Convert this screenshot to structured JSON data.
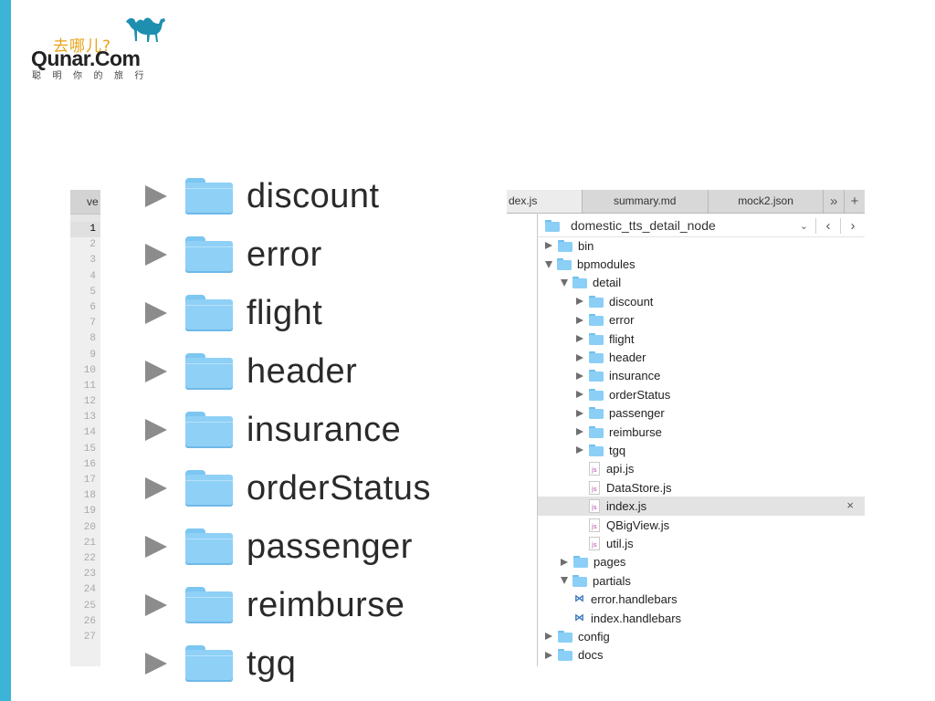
{
  "logo": {
    "cn_text": "去哪儿?",
    "brand": "Qunar.Com",
    "slogan": "聪明你的旅行"
  },
  "colors": {
    "accent_bar": "#3bb4d8",
    "folder": "#8fd0f6",
    "brand_orange": "#e8a317",
    "camel": "#1f8fb0"
  },
  "editor": {
    "tab_label": "ve",
    "current_line": 1,
    "line_numbers": [
      "1",
      "2",
      "3",
      "4",
      "5",
      "6",
      "7",
      "8",
      "9",
      "10",
      "11",
      "12",
      "13",
      "14",
      "15",
      "16",
      "17",
      "18",
      "19",
      "20",
      "21",
      "22",
      "23",
      "24",
      "25",
      "26",
      "27"
    ]
  },
  "zoom_list": {
    "items": [
      {
        "label": "discount",
        "icon": "folder-icon"
      },
      {
        "label": "error",
        "icon": "folder-icon"
      },
      {
        "label": "flight",
        "icon": "folder-icon"
      },
      {
        "label": "header",
        "icon": "folder-icon"
      },
      {
        "label": "insurance",
        "icon": "folder-icon"
      },
      {
        "label": "orderStatus",
        "icon": "folder-icon"
      },
      {
        "label": "passenger",
        "icon": "folder-icon"
      },
      {
        "label": "reimburse",
        "icon": "folder-icon"
      },
      {
        "label": "tgq",
        "icon": "folder-icon"
      }
    ]
  },
  "ide": {
    "tabs": [
      {
        "label": "dex.js",
        "active": true
      },
      {
        "label": "summary.md",
        "active": false
      },
      {
        "label": "mock2.json",
        "active": false
      }
    ],
    "tab_overflow": "»",
    "tab_add": "+",
    "project": {
      "name": "domestic_tts_detail_node",
      "dropdown": "⌄",
      "back": "‹",
      "forward": "›"
    },
    "close_glyph": "×",
    "tree": [
      {
        "label": "bin",
        "type": "folder",
        "depth": 0,
        "state": "collapsed"
      },
      {
        "label": "bpmodules",
        "type": "folder",
        "depth": 0,
        "state": "expanded"
      },
      {
        "label": "detail",
        "type": "folder",
        "depth": 1,
        "state": "expanded"
      },
      {
        "label": "discount",
        "type": "folder",
        "depth": 2,
        "state": "collapsed"
      },
      {
        "label": "error",
        "type": "folder",
        "depth": 2,
        "state": "collapsed"
      },
      {
        "label": "flight",
        "type": "folder",
        "depth": 2,
        "state": "collapsed"
      },
      {
        "label": "header",
        "type": "folder",
        "depth": 2,
        "state": "collapsed"
      },
      {
        "label": "insurance",
        "type": "folder",
        "depth": 2,
        "state": "collapsed"
      },
      {
        "label": "orderStatus",
        "type": "folder",
        "depth": 2,
        "state": "collapsed"
      },
      {
        "label": "passenger",
        "type": "folder",
        "depth": 2,
        "state": "collapsed"
      },
      {
        "label": "reimburse",
        "type": "folder",
        "depth": 2,
        "state": "collapsed"
      },
      {
        "label": "tgq",
        "type": "folder",
        "depth": 2,
        "state": "collapsed"
      },
      {
        "label": "api.js",
        "type": "js",
        "depth": 2
      },
      {
        "label": "DataStore.js",
        "type": "js",
        "depth": 2
      },
      {
        "label": "index.js",
        "type": "js",
        "depth": 2,
        "selected": true
      },
      {
        "label": "QBigView.js",
        "type": "js",
        "depth": 2
      },
      {
        "label": "util.js",
        "type": "js",
        "depth": 2
      },
      {
        "label": "pages",
        "type": "folder",
        "depth": 1,
        "state": "collapsed"
      },
      {
        "label": "partials",
        "type": "folder",
        "depth": 1,
        "state": "expanded"
      },
      {
        "label": "error.handlebars",
        "type": "hbs",
        "depth": 1
      },
      {
        "label": "index.handlebars",
        "type": "hbs",
        "depth": 1
      },
      {
        "label": "config",
        "type": "folder",
        "depth": 0,
        "state": "collapsed"
      },
      {
        "label": "docs",
        "type": "folder",
        "depth": 0,
        "state": "collapsed"
      }
    ]
  }
}
